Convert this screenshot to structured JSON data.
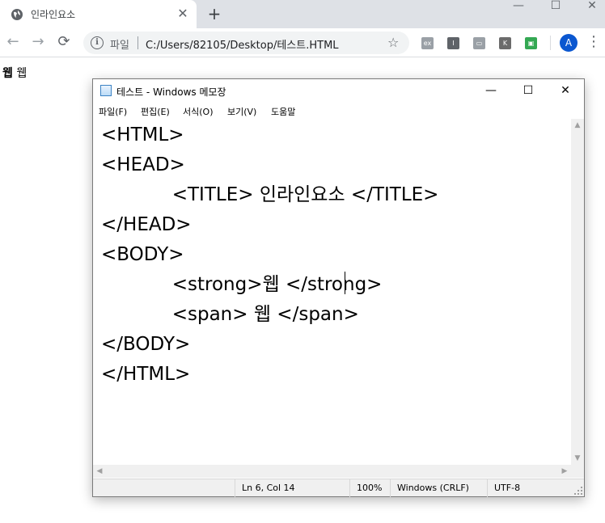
{
  "browser": {
    "tab": {
      "title": "인라인요소",
      "close": "✕",
      "favicon": "globe-icon"
    },
    "new_tab": "+",
    "window_controls": {
      "minimize": "—",
      "maximize": "☐",
      "close": "✕"
    },
    "nav": {
      "back": "←",
      "forward": "→",
      "reload": "⟳"
    },
    "omnibox": {
      "info": "i",
      "scheme": "파일",
      "url": "C:/Users/82105/Desktop/테스트.HTML",
      "star": "☆"
    },
    "extensions": [
      {
        "name": "ext-icon-1",
        "label": "ex"
      },
      {
        "name": "ext-icon-2",
        "label": "I"
      },
      {
        "name": "ext-icon-3",
        "label": "▭"
      },
      {
        "name": "ext-icon-4",
        "label": "K"
      },
      {
        "name": "ext-icon-5",
        "label": "▣"
      }
    ],
    "avatar": "A",
    "menu": "⋮"
  },
  "page": {
    "strong_text": "웹",
    "span_text": "웹"
  },
  "notepad": {
    "title": "테스트 - Windows 메모장",
    "controls": {
      "minimize": "—",
      "maximize": "☐",
      "close": "✕"
    },
    "menus": [
      "파일(F)",
      "편집(E)",
      "서식(O)",
      "보기(V)",
      "도움말"
    ],
    "lines": [
      "<HTML>",
      "<HEAD>",
      "            <TITLE> 인라인요소 </TITLE>",
      "</HEAD>",
      "<BODY>",
      "            <strong>웹 </strong>",
      "            <span> 웹 </span>",
      "</BODY>",
      "</HTML>"
    ],
    "status": {
      "position": "Ln 6, Col 14",
      "zoom": "100%",
      "line_ending": "Windows (CRLF)",
      "encoding": "UTF-8"
    }
  },
  "colors": {
    "chrome_tabbar": "#dee1e6",
    "omnibox": "#f1f3f4",
    "avatar": "#0b57d0",
    "statusbar": "#f0f0f0"
  }
}
